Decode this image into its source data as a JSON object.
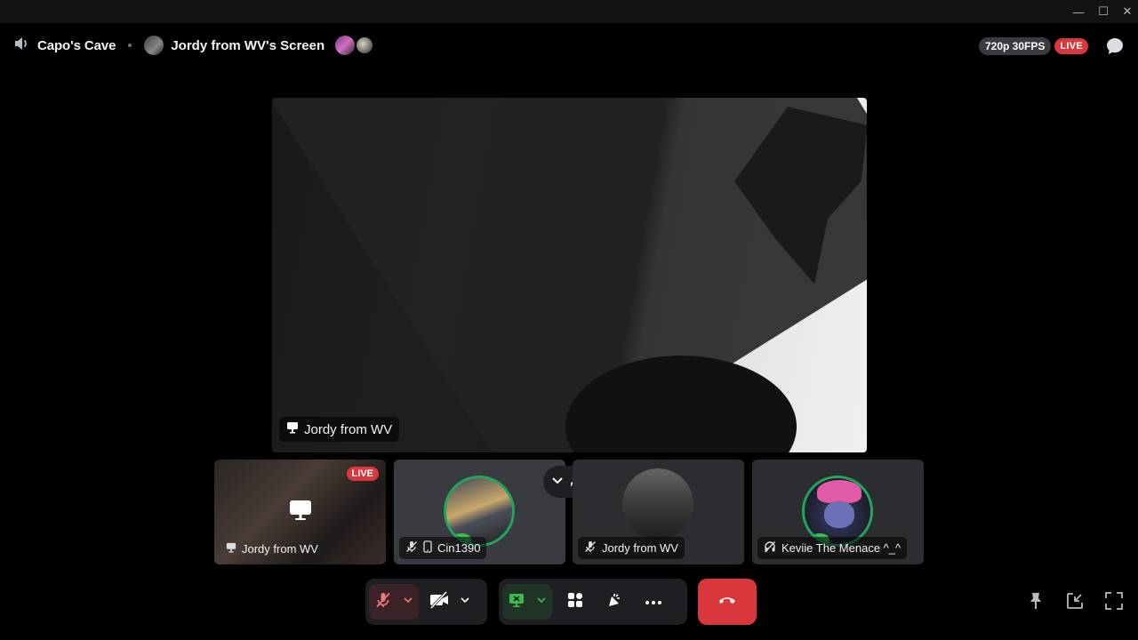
{
  "window": {
    "minimize_glyph": "—",
    "maximize_glyph": "☐",
    "close_glyph": "✕"
  },
  "header": {
    "channel_icon": "speaker-icon",
    "channel_name": "Capo's Cave",
    "screen_title": "Jordy from WV's Screen",
    "stream_quality": "720p 30FPS",
    "live_badge": "LIVE"
  },
  "main_stream": {
    "label": "Jordy from WV",
    "label_icon": "monitor-icon"
  },
  "participants": [
    {
      "name": "Jordy from WV",
      "status_icon": "monitor-icon",
      "badge": "LIVE"
    },
    {
      "name": "Cin1390",
      "status_icon": "mic-muted-icon",
      "extra_icon": "phone-icon"
    },
    {
      "name": "Jordy from WV",
      "status_icon": "mic-muted-icon"
    },
    {
      "name": "Keviie The Menace ^_^",
      "status_icon": "deafened-icon"
    }
  ],
  "controls": {
    "mic": "mic-muted-icon",
    "camera": "camera-off-icon",
    "screen_share": "screen-share-icon",
    "activities": "activities-icon",
    "soundboard": "soundboard-icon",
    "more": "more-icon",
    "hang_up": "hang-up-icon"
  },
  "colors": {
    "live_red": "#da373c",
    "speaking_green": "#23a55a",
    "control_bg": "#1e1f22"
  }
}
